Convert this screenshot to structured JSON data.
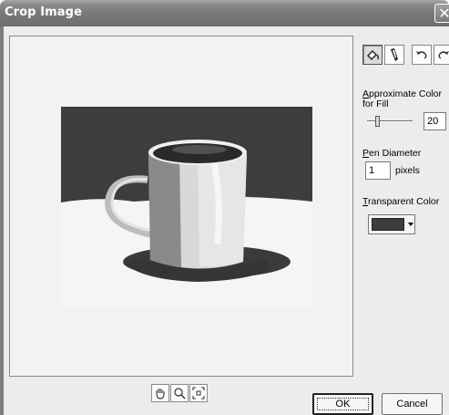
{
  "window": {
    "title": "Crop Image",
    "close_glyph": "✕"
  },
  "tools": {
    "fill": "paint-bucket-icon",
    "pen": "pen-icon",
    "undo": "undo-icon",
    "redo": "redo-icon"
  },
  "panel": {
    "approx_color_label_prefix": "",
    "approx_color_label_u": "A",
    "approx_color_label_rest": "pproximate Color",
    "approx_color_label_line2": "for Fill",
    "approx_color_value": "20",
    "approx_color_level": 0.2,
    "pen_label_u": "P",
    "pen_label_rest": "en Diameter",
    "pen_value": "1",
    "pen_units": "pixels",
    "transparent_label_u": "T",
    "transparent_label_rest": "ransparent Color",
    "transparent_color": "#3d3d3d"
  },
  "view_tools": [
    "pan-hand-icon",
    "zoom-icon",
    "fit-icon"
  ],
  "buttons": {
    "ok": "OK",
    "cancel": "Cancel"
  },
  "colors": {
    "titlebar": "#777777",
    "dialog_bg": "#ececec"
  }
}
